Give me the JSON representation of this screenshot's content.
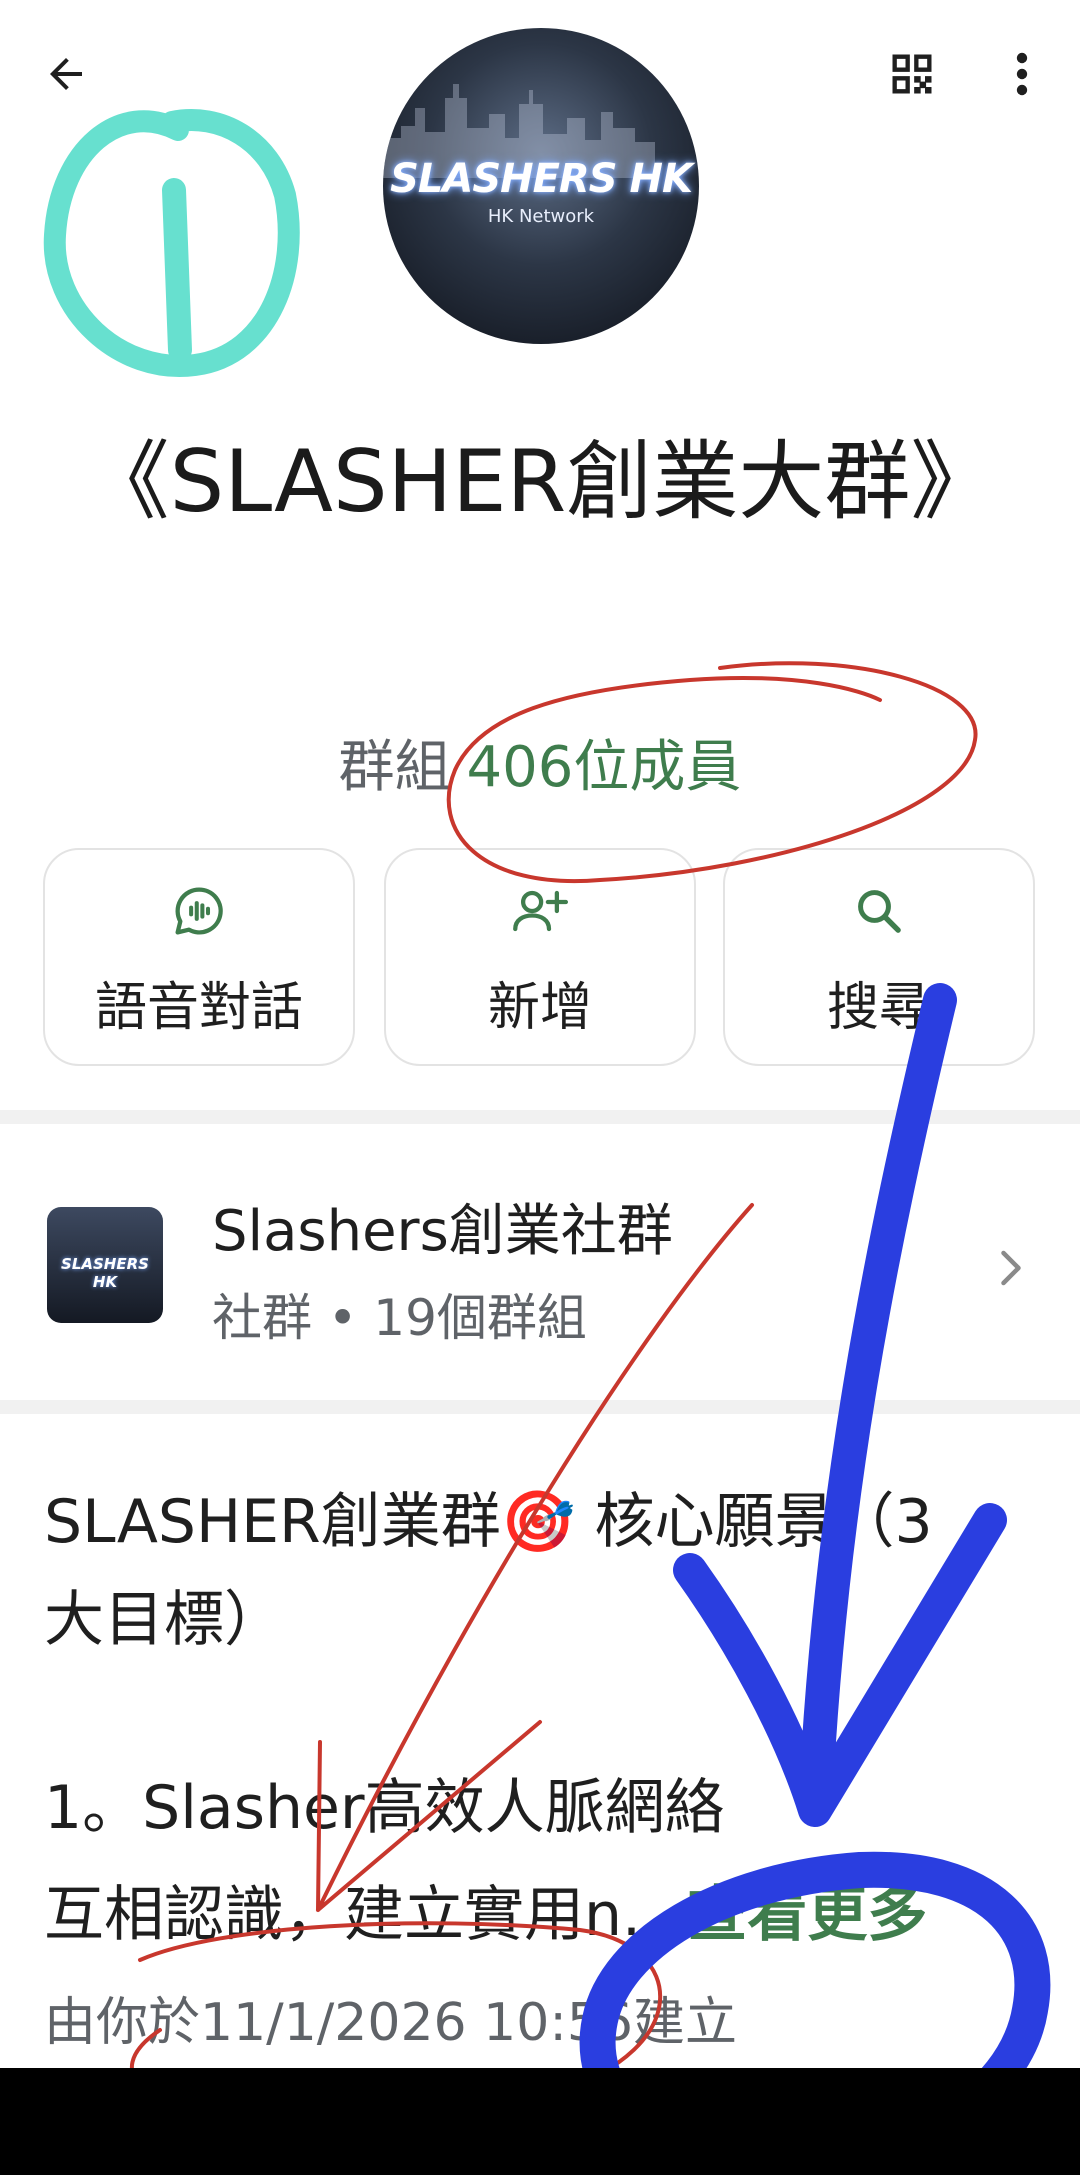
{
  "header": {
    "back_icon": "arrow-left-icon",
    "qr_icon": "qr-code-icon",
    "more_icon": "more-vert-icon"
  },
  "avatar": {
    "brand": "SLASHERS HK",
    "subtitle": "HK Network"
  },
  "group": {
    "title": "《SLASHER創業大群》",
    "kind": "群組",
    "members": "406位成員"
  },
  "actions": [
    {
      "label": "語音對話",
      "icon": "voice-chat-icon"
    },
    {
      "label": "新增",
      "icon": "add-person-icon"
    },
    {
      "label": "搜尋",
      "icon": "search-icon"
    }
  ],
  "community": {
    "thumb_text": "SLASHERS HK",
    "name": "Slashers創業社群",
    "subtitle": "社群 • 19個群組"
  },
  "description": {
    "line1": "SLASHER創業群🎯 核心願景（3",
    "line2": "大目標）",
    "line3": "1。Slasher高效人脈網絡",
    "line4": "互相認識，建立實用n...",
    "more": "查看更多"
  },
  "created": "由你於11/1/2026 10:56建立",
  "colors": {
    "accent_green": "#3f7d4d",
    "annotation_teal": "#67e0cf",
    "annotation_red": "#c8372d",
    "annotation_blue": "#2a3ee0"
  }
}
